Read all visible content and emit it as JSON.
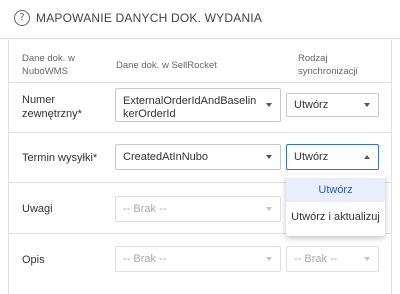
{
  "header": {
    "title": "MAPOWANIE DANYCH DOK. WYDANIA",
    "help_icon": "?"
  },
  "columns": {
    "nubo": [
      "Dane dok. w",
      "NuboWMS"
    ],
    "sellrocket": "Dane dok. w SellRocket",
    "sync": [
      "Rodzaj",
      "synchronizacji"
    ]
  },
  "rows": [
    {
      "label": [
        "Numer",
        "zewnętrzny*"
      ],
      "source": [
        "ExternalOrderIdAndBaselin",
        "kerOrderId"
      ],
      "sync": "Utwórz"
    },
    {
      "label": [
        "Termin wysyłki*"
      ],
      "source": [
        "CreatedAtInNubo"
      ],
      "sync": "Utwórz"
    },
    {
      "label": [
        "Uwagi"
      ],
      "source": [
        "-- Brak --"
      ],
      "sync": ""
    },
    {
      "label": [
        "Opis"
      ],
      "source": [
        "-- Brak --"
      ],
      "sync": "-- Brak --"
    }
  ],
  "dropdown": {
    "options": [
      "Utwórz",
      "Utwórz i aktualizuj"
    ],
    "selected": "Utwórz"
  },
  "colors": {
    "accent": "#3b6fd1",
    "selected_bg": "#e8eefb"
  }
}
